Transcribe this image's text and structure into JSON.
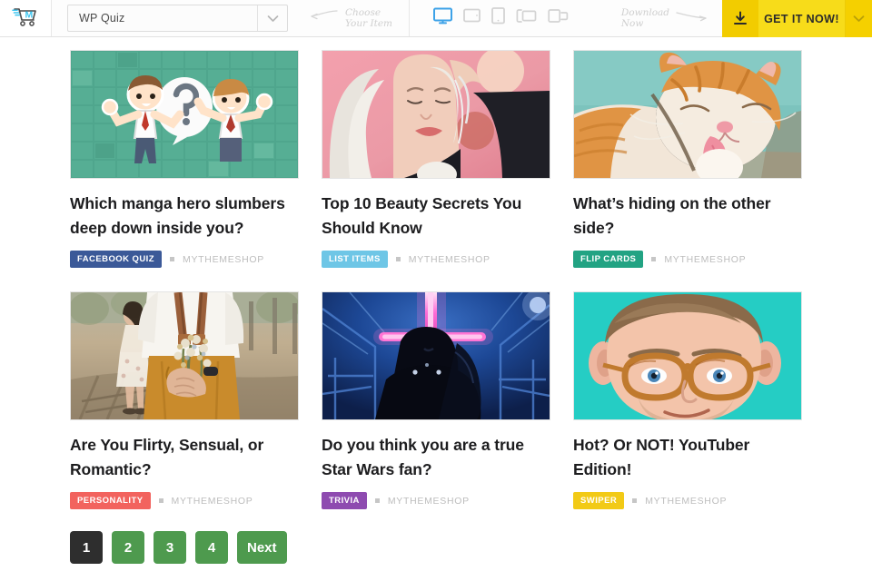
{
  "topbar": {
    "logo_icon": "shopping-cart-logo",
    "item_select": {
      "value": "WP Quiz",
      "placeholder": "Select item",
      "caret_icon": "chevron-down-icon"
    },
    "hint_choose": {
      "line1": "Choose",
      "line2": "Your Item",
      "arrow_icon": "arrow-left-icon"
    },
    "devices": [
      {
        "name": "desktop-preview",
        "icon": "desktop-icon",
        "active": true
      },
      {
        "name": "tablet-landscape-preview",
        "icon": "tablet-landscape-icon",
        "active": false
      },
      {
        "name": "tablet-portrait-preview",
        "icon": "tablet-portrait-icon",
        "active": false
      },
      {
        "name": "mobile-landscape-preview",
        "icon": "mobile-landscape-icon",
        "active": false
      },
      {
        "name": "mobile-portrait-preview",
        "icon": "mobile-portrait-icon",
        "active": false
      }
    ],
    "hint_download": {
      "line1": "Download",
      "line2": "Now",
      "arrow_icon": "arrow-right-icon"
    },
    "cta": {
      "label": "GET IT NOW!",
      "download_icon": "download-icon",
      "caret_icon": "chevron-down-icon",
      "color": "#f5d000"
    }
  },
  "cards": [
    {
      "title": "Which manga hero slumbers deep down inside you?",
      "badge": "FACEBOOK QUIZ",
      "badge_color": "#3b5998",
      "author": "MYTHEMESHOP",
      "image": "manga-quiz-thumbnail"
    },
    {
      "title": "Top 10 Beauty Secrets You Should Know",
      "badge": "LIST ITEMS",
      "badge_color": "#6ec6e6",
      "author": "MYTHEMESHOP",
      "image": "beauty-secrets-thumbnail"
    },
    {
      "title": "What’s hiding on the other side?",
      "badge": "FLIP CARDS",
      "badge_color": "#22a383",
      "author": "MYTHEMESHOP",
      "image": "cat-flip-cards-thumbnail"
    },
    {
      "title": "Are You Flirty, Sensual, or Romantic?",
      "badge": "PERSONALITY",
      "badge_color": "#f2635e",
      "author": "MYTHEMESHOP",
      "image": "couple-personality-thumbnail"
    },
    {
      "title": "Do you think you are a true Star Wars fan?",
      "badge": "TRIVIA",
      "badge_color": "#8e4bb0",
      "author": "MYTHEMESHOP",
      "image": "star-wars-trivia-thumbnail"
    },
    {
      "title": "Hot? Or NOT! YouTuber Edition!",
      "badge": "SWIPER",
      "badge_color": "#f2ca16",
      "author": "MYTHEMESHOP",
      "image": "youtuber-swiper-thumbnail"
    }
  ],
  "pagination": {
    "pages": [
      "1",
      "2",
      "3",
      "4"
    ],
    "next_label": "Next",
    "current": "1",
    "active_color": "#2e2e2e",
    "page_color": "#4e9a4e"
  }
}
